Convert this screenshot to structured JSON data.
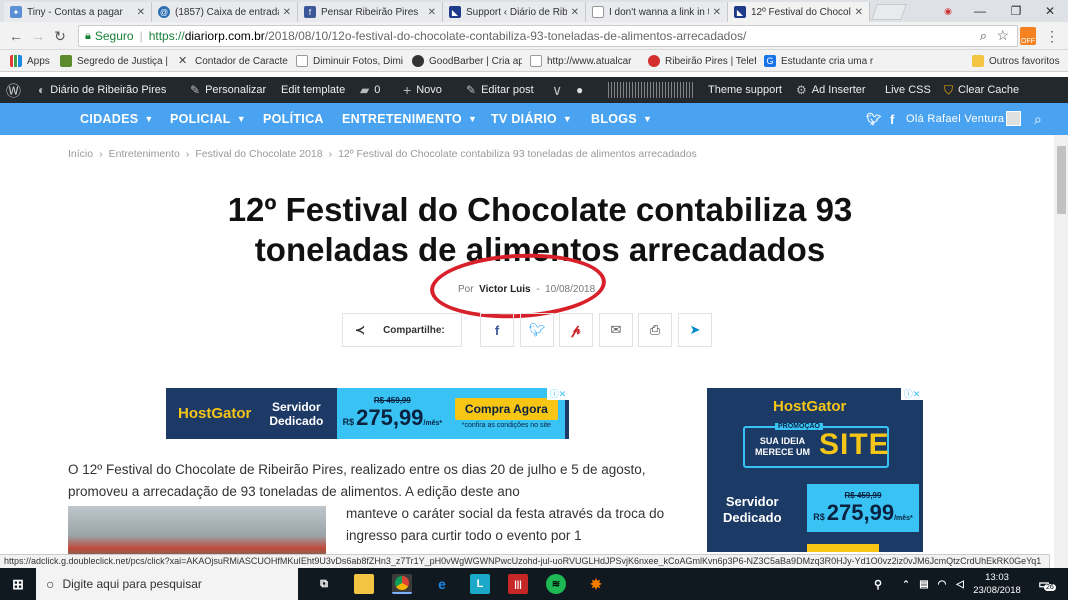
{
  "browser": {
    "tabs": [
      {
        "title": "Tiny - Contas a pagar",
        "color": "#5a8fd6"
      },
      {
        "title": "(1857) Caixa de entrada",
        "color": "#2b6fb3"
      },
      {
        "title": "Pensar Ribeirão Pires",
        "color": "#3b5998"
      },
      {
        "title": "Support ‹ Diário de Rib",
        "color": "#1e3a8a"
      },
      {
        "title": "I don't wanna a link in t",
        "color": "#999999"
      },
      {
        "title": "12º Festival do Chocola",
        "color": "#1e3a8a"
      }
    ],
    "address": {
      "secure_label": "Seguro",
      "url_scheme": "https://",
      "url_host": "diariorp.com.br",
      "url_path": "/2018/08/10/12o-festival-do-chocolate-contabiliza-93-toneladas-de-alimentos-arrecadados/"
    },
    "bookmarks": [
      {
        "label": "Apps"
      },
      {
        "label": "Segredo de Justiça |"
      },
      {
        "label": "Contador de Caracte"
      },
      {
        "label": "Diminuir Fotos, Dimi"
      },
      {
        "label": "GoodBarber | Cria ap"
      },
      {
        "label": "http://www.atualcar"
      },
      {
        "label": "Ribeirão Pires | Telef"
      },
      {
        "label": "Estudante cria uma r"
      },
      {
        "label": "Outros favoritos"
      }
    ]
  },
  "wp_bar": {
    "site_name": "Diário de Ribeirão Pires",
    "customize": "Personalizar",
    "edit_template": "Edit template",
    "comments": "0",
    "new": "Novo",
    "edit_post": "Editar post",
    "theme_support": "Theme support",
    "ad_inserter": "Ad Inserter",
    "live_css": "Live CSS",
    "clear_cache": "Clear Cache"
  },
  "site_nav": {
    "items": [
      {
        "label": "CIDADES",
        "dropdown": true
      },
      {
        "label": "POLICIAL",
        "dropdown": true
      },
      {
        "label": "POLÍTICA",
        "dropdown": false
      },
      {
        "label": "ENTRETENIMENTO",
        "dropdown": true
      },
      {
        "label": "TV DIÁRIO",
        "dropdown": true
      },
      {
        "label": "BLOGS",
        "dropdown": true
      }
    ],
    "greeting": "Olá Rafael Ventura"
  },
  "article": {
    "breadcrumbs": [
      "Início",
      "Entretenimento",
      "Festival do Chocolate 2018",
      "12º Festival do Chocolate contabiliza 93 toneladas de alimentos arrecadados"
    ],
    "title": "12º Festival do Chocolate contabiliza 93 toneladas de alimentos arrecadados",
    "by_prefix": "Por",
    "author": "Victor Luis",
    "date_sep": "-",
    "date": "10/08/2018",
    "share_label": "Compartilhe:",
    "body_p1": "O 12º Festival do Chocolate de Ribeirão Pires, realizado entre os dias 20 de julho e 5 de agosto, promoveu a arrecadação de 93 toneladas de alimentos. A edição deste ano",
    "body_p2": "manteve o caráter social da festa através da troca do ingresso para curtir todo o evento por 1"
  },
  "ads": {
    "banner": {
      "brand": "HostGator",
      "line1": "Servidor",
      "line2": "Dedicado",
      "old_price": "R$ 459,99",
      "currency": "R$",
      "price": "275,99",
      "per": "/mês*",
      "cta": "Compra Agora",
      "note": "*confira as condições no site"
    },
    "side": {
      "brand": "HostGator",
      "promo": "PROMOÇÃO",
      "line_a": "SUA IDEIA",
      "line_b": "MERECE UM",
      "site": "SITE",
      "line1": "Servidor",
      "line2": "Dedicado",
      "old_price": "R$ 459,99",
      "currency": "R$",
      "price": "275,99",
      "per": "/mês*"
    }
  },
  "status_url": "https://adclick.g.doubleclick.net/pcs/click?xai=AKAOjsuRMiASCUOHfMKuIEht9U3vDs6ab8fZHn3_z7Tr1Y_pH0vWgWGWNPwcUzohd-jul-uoRVUGLHdJPSvjK6nxee_kCoAGmlKvn6p3P6-NZ3C5aBa9DMzq3R0HJy-Yd1O0vz2iz0vJM6JcmQtzCrdUhEkRK0GeYq1",
  "taskbar": {
    "search_placeholder": "Digite aqui para pesquisar",
    "time": "13:03",
    "date": "23/08/2018",
    "notifications": "26"
  }
}
